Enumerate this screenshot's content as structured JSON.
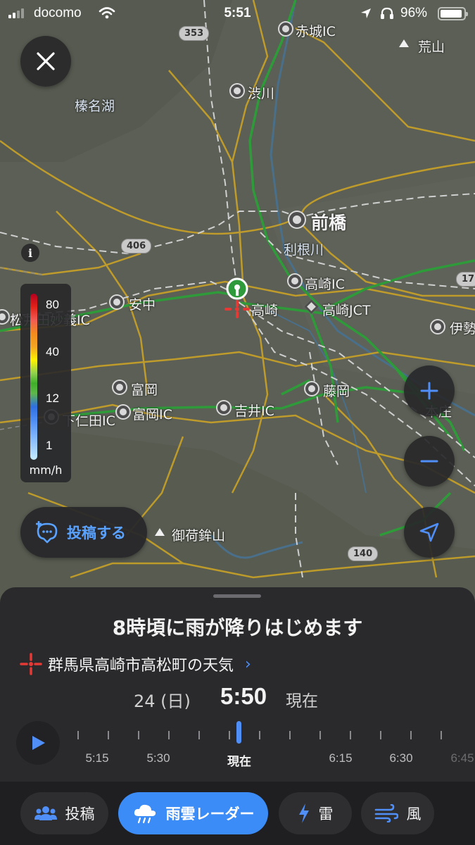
{
  "status_bar": {
    "carrier": "docomo",
    "time": "5:51",
    "battery": "96%"
  },
  "map": {
    "places": [
      {
        "id": "akagi-ic",
        "label": "赤城IC"
      },
      {
        "id": "arayama",
        "label": "荒山"
      },
      {
        "id": "shibukawa",
        "label": "渋川"
      },
      {
        "id": "haruna-lake",
        "label": "榛名湖"
      },
      {
        "id": "maebashi",
        "label": "前橋"
      },
      {
        "id": "tonegawa",
        "label": "利根川"
      },
      {
        "id": "takasaki-ic",
        "label": "高崎IC"
      },
      {
        "id": "takasaki",
        "label": "高崎"
      },
      {
        "id": "takasaki-jct",
        "label": "高崎JCT"
      },
      {
        "id": "annaka",
        "label": "安中"
      },
      {
        "id": "matsuida-ic",
        "label": "松井田妙義IC"
      },
      {
        "id": "isesaki",
        "label": "伊勢"
      },
      {
        "id": "tomioka",
        "label": "富岡"
      },
      {
        "id": "fujioka",
        "label": "藤岡"
      },
      {
        "id": "honjo",
        "label": "本庄"
      },
      {
        "id": "tomioka-ic",
        "label": "富岡IC"
      },
      {
        "id": "yoshii-ic",
        "label": "吉井IC"
      },
      {
        "id": "shimonita-ic",
        "label": "下仁田IC"
      },
      {
        "id": "mikabosan",
        "label": "御荷鉾山"
      }
    ],
    "route_shields": [
      "353",
      "406",
      "17",
      "140"
    ]
  },
  "legend": {
    "ticks": [
      "80",
      "40",
      "12",
      "1"
    ],
    "unit": "mm/h"
  },
  "post_button": {
    "label": "投稿する"
  },
  "sheet": {
    "headline": "8時頃に雨が降りはじめます",
    "location": "群馬県高崎市高松町の天気",
    "date": "24 (日)",
    "time": "5:50",
    "now_label": "現在"
  },
  "timeline": {
    "labels": [
      "5:15",
      "5:30",
      "現在",
      "6:15",
      "6:30",
      "6:45"
    ],
    "current_index": 2
  },
  "tabs": [
    {
      "label": "投稿",
      "icon": "people-icon",
      "active": false
    },
    {
      "label": "雨雲レーダー",
      "icon": "rain-cloud-icon",
      "active": true
    },
    {
      "label": "雷",
      "icon": "lightning-icon",
      "active": false
    },
    {
      "label": "風",
      "icon": "wind-icon",
      "active": false
    }
  ],
  "colors": {
    "accent": "#3b8cf7",
    "map_bg": "#5b5f55",
    "road_major": "#c9a227",
    "expressway": "#2f9a3a",
    "sheet_bg": "#2a2a2c"
  }
}
